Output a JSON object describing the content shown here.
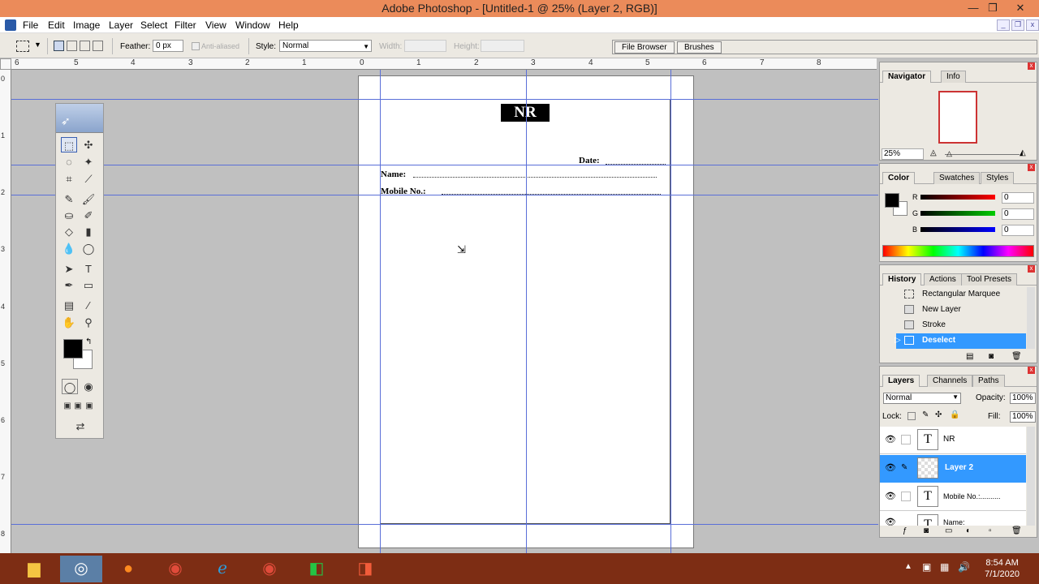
{
  "window": {
    "title": "Adobe Photoshop - [Untitled-1 @ 25% (Layer 2, RGB)]"
  },
  "menu": [
    "File",
    "Edit",
    "Image",
    "Layer",
    "Select",
    "Filter",
    "View",
    "Window",
    "Help"
  ],
  "options": {
    "feather_label": "Feather:",
    "feather_value": "0 px",
    "antialiased_label": "Anti-aliased",
    "style_label": "Style:",
    "style_value": "Normal",
    "width_label": "Width:",
    "height_label": "Height:",
    "file_browser_tab": "File Browser",
    "brushes_tab": "Brushes"
  },
  "ruler_top": [
    "6",
    "5",
    "4",
    "3",
    "2",
    "1",
    "0",
    "1",
    "2",
    "3",
    "4",
    "5",
    "6",
    "7",
    "8"
  ],
  "ruler_left": [
    "0",
    "1",
    "2",
    "3",
    "4",
    "5",
    "6",
    "7",
    "8"
  ],
  "document": {
    "logo_text": "NR",
    "date_label": "Date:",
    "name_label": "Name:",
    "mobile_label": "Mobile No.:"
  },
  "navigator": {
    "tabs": [
      "Navigator",
      "Info"
    ],
    "zoom": "25%"
  },
  "color": {
    "tabs": [
      "Color",
      "Swatches",
      "Styles"
    ],
    "channels": [
      {
        "label": "R",
        "value": "0",
        "color": "#cc0000"
      },
      {
        "label": "G",
        "value": "0",
        "color": "#00aa00"
      },
      {
        "label": "B",
        "value": "0",
        "color": "#0000cc"
      }
    ]
  },
  "history": {
    "tabs": [
      "History",
      "Actions",
      "Tool Presets"
    ],
    "items": [
      "Rectangular Marquee",
      "New Layer",
      "Stroke",
      "Deselect"
    ],
    "selected": "Deselect"
  },
  "layers": {
    "tabs": [
      "Layers",
      "Channels",
      "Paths"
    ],
    "blend_mode": "Normal",
    "opacity_label": "Opacity:",
    "opacity_value": "100%",
    "lock_label": "Lock:",
    "fill_label": "Fill:",
    "fill_value": "100%",
    "items": [
      {
        "name": "NR",
        "type": "text"
      },
      {
        "name": "Layer 2",
        "type": "raster",
        "selected": true
      },
      {
        "name": "Mobile No.:..........",
        "type": "text"
      },
      {
        "name": "Name:",
        "type": "text"
      }
    ]
  },
  "taskbar": {
    "time": "8:54 AM",
    "date": "7/1/2020",
    "apps": [
      "explorer-icon",
      "photoshop-icon",
      "firefox-icon",
      "chrome-icon",
      "ie-icon",
      "chrome-icon",
      "camtasia-icon",
      "camtasia-recorder-icon"
    ]
  },
  "colors": {
    "selection": "#3399ff",
    "title_bar": "#eb8b5a",
    "taskbar": "#7d2d14"
  }
}
